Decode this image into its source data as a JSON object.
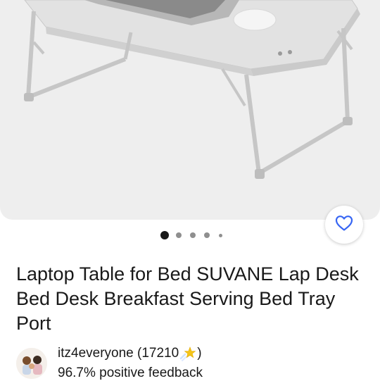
{
  "listing": {
    "title": "Laptop Table for Bed SUVANE Lap Desk Bed Desk Breakfast Serving Bed Tray Port",
    "image_alt": "product-photo-laptop-table",
    "gallery": {
      "total_images": 5,
      "active_index": 0
    },
    "favorite_icon": "heart-outline-icon"
  },
  "seller": {
    "username": "itz4everyone",
    "feedback_open": "(17210",
    "feedback_close": ")",
    "star_icon": "shooting-star-icon",
    "positive_feedback": "96.7% positive feedback"
  },
  "colors": {
    "accent": "#3665f3",
    "text": "#191919",
    "hero_bg": "#eeeeee",
    "dot": "#8f8f8f",
    "dot_active": "#191919",
    "star": "#f5c518"
  }
}
